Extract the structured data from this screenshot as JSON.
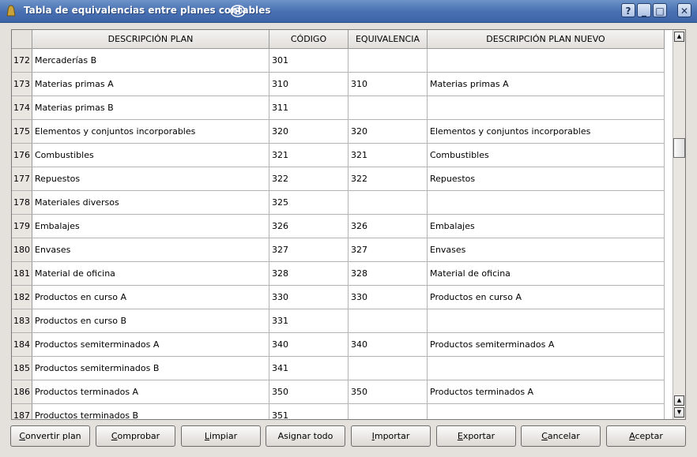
{
  "window": {
    "title": "Tabla de equivalencias entre planes contables",
    "controls": {
      "help": "?",
      "minimize": "_",
      "maximize": "□",
      "close": "✕"
    }
  },
  "table": {
    "columns": [
      "DESCRIPCIÓN PLAN",
      "CÓDIGO",
      "EQUIVALENCIA",
      "DESCRIPCIÓN PLAN NUEVO"
    ],
    "rows": [
      {
        "n": "172",
        "desc": "Mercaderías B",
        "code": "301",
        "equiv": "",
        "newdesc": ""
      },
      {
        "n": "173",
        "desc": "Materias primas A",
        "code": "310",
        "equiv": "310",
        "newdesc": "Materias primas A"
      },
      {
        "n": "174",
        "desc": "Materias primas B",
        "code": "311",
        "equiv": "",
        "newdesc": ""
      },
      {
        "n": "175",
        "desc": "Elementos y conjuntos incorporables",
        "code": "320",
        "equiv": "320",
        "newdesc": "Elementos y conjuntos incorporables"
      },
      {
        "n": "176",
        "desc": "Combustibles",
        "code": "321",
        "equiv": "321",
        "newdesc": "Combustibles"
      },
      {
        "n": "177",
        "desc": "Repuestos",
        "code": "322",
        "equiv": "322",
        "newdesc": "Repuestos"
      },
      {
        "n": "178",
        "desc": "Materiales diversos",
        "code": "325",
        "equiv": "",
        "newdesc": ""
      },
      {
        "n": "179",
        "desc": "Embalajes",
        "code": "326",
        "equiv": "326",
        "newdesc": "Embalajes"
      },
      {
        "n": "180",
        "desc": "Envases",
        "code": "327",
        "equiv": "327",
        "newdesc": "Envases"
      },
      {
        "n": "181",
        "desc": "Material de oficina",
        "code": "328",
        "equiv": "328",
        "newdesc": "Material de oficina"
      },
      {
        "n": "182",
        "desc": "Productos en curso A",
        "code": "330",
        "equiv": "330",
        "newdesc": "Productos en curso A"
      },
      {
        "n": "183",
        "desc": "Productos en curso B",
        "code": "331",
        "equiv": "",
        "newdesc": ""
      },
      {
        "n": "184",
        "desc": "Productos semiterminados A",
        "code": "340",
        "equiv": "340",
        "newdesc": "Productos semiterminados A"
      },
      {
        "n": "185",
        "desc": "Productos semiterminados B",
        "code": "341",
        "equiv": "",
        "newdesc": ""
      },
      {
        "n": "186",
        "desc": "Productos terminados A",
        "code": "350",
        "equiv": "350",
        "newdesc": "Productos terminados A"
      },
      {
        "n": "187",
        "desc": "Productos terminados B",
        "code": "351",
        "equiv": "",
        "newdesc": ""
      }
    ]
  },
  "buttons": [
    {
      "name": "convertir-plan-button",
      "mnemonic": "C",
      "rest": "onvertir plan"
    },
    {
      "name": "comprobar-button",
      "mnemonic": "C",
      "rest": "omprobar"
    },
    {
      "name": "limpiar-button",
      "mnemonic": "L",
      "rest": "impiar"
    },
    {
      "name": "asignar-todo-button",
      "mnemonic": "",
      "rest": "Asignar todo"
    },
    {
      "name": "importar-button",
      "mnemonic": "I",
      "rest": "mportar"
    },
    {
      "name": "exportar-button",
      "mnemonic": "E",
      "rest": "xportar"
    },
    {
      "name": "cancelar-button",
      "mnemonic": "C",
      "rest": "ancelar"
    },
    {
      "name": "aceptar-button",
      "mnemonic": "A",
      "rest": "ceptar"
    }
  ]
}
